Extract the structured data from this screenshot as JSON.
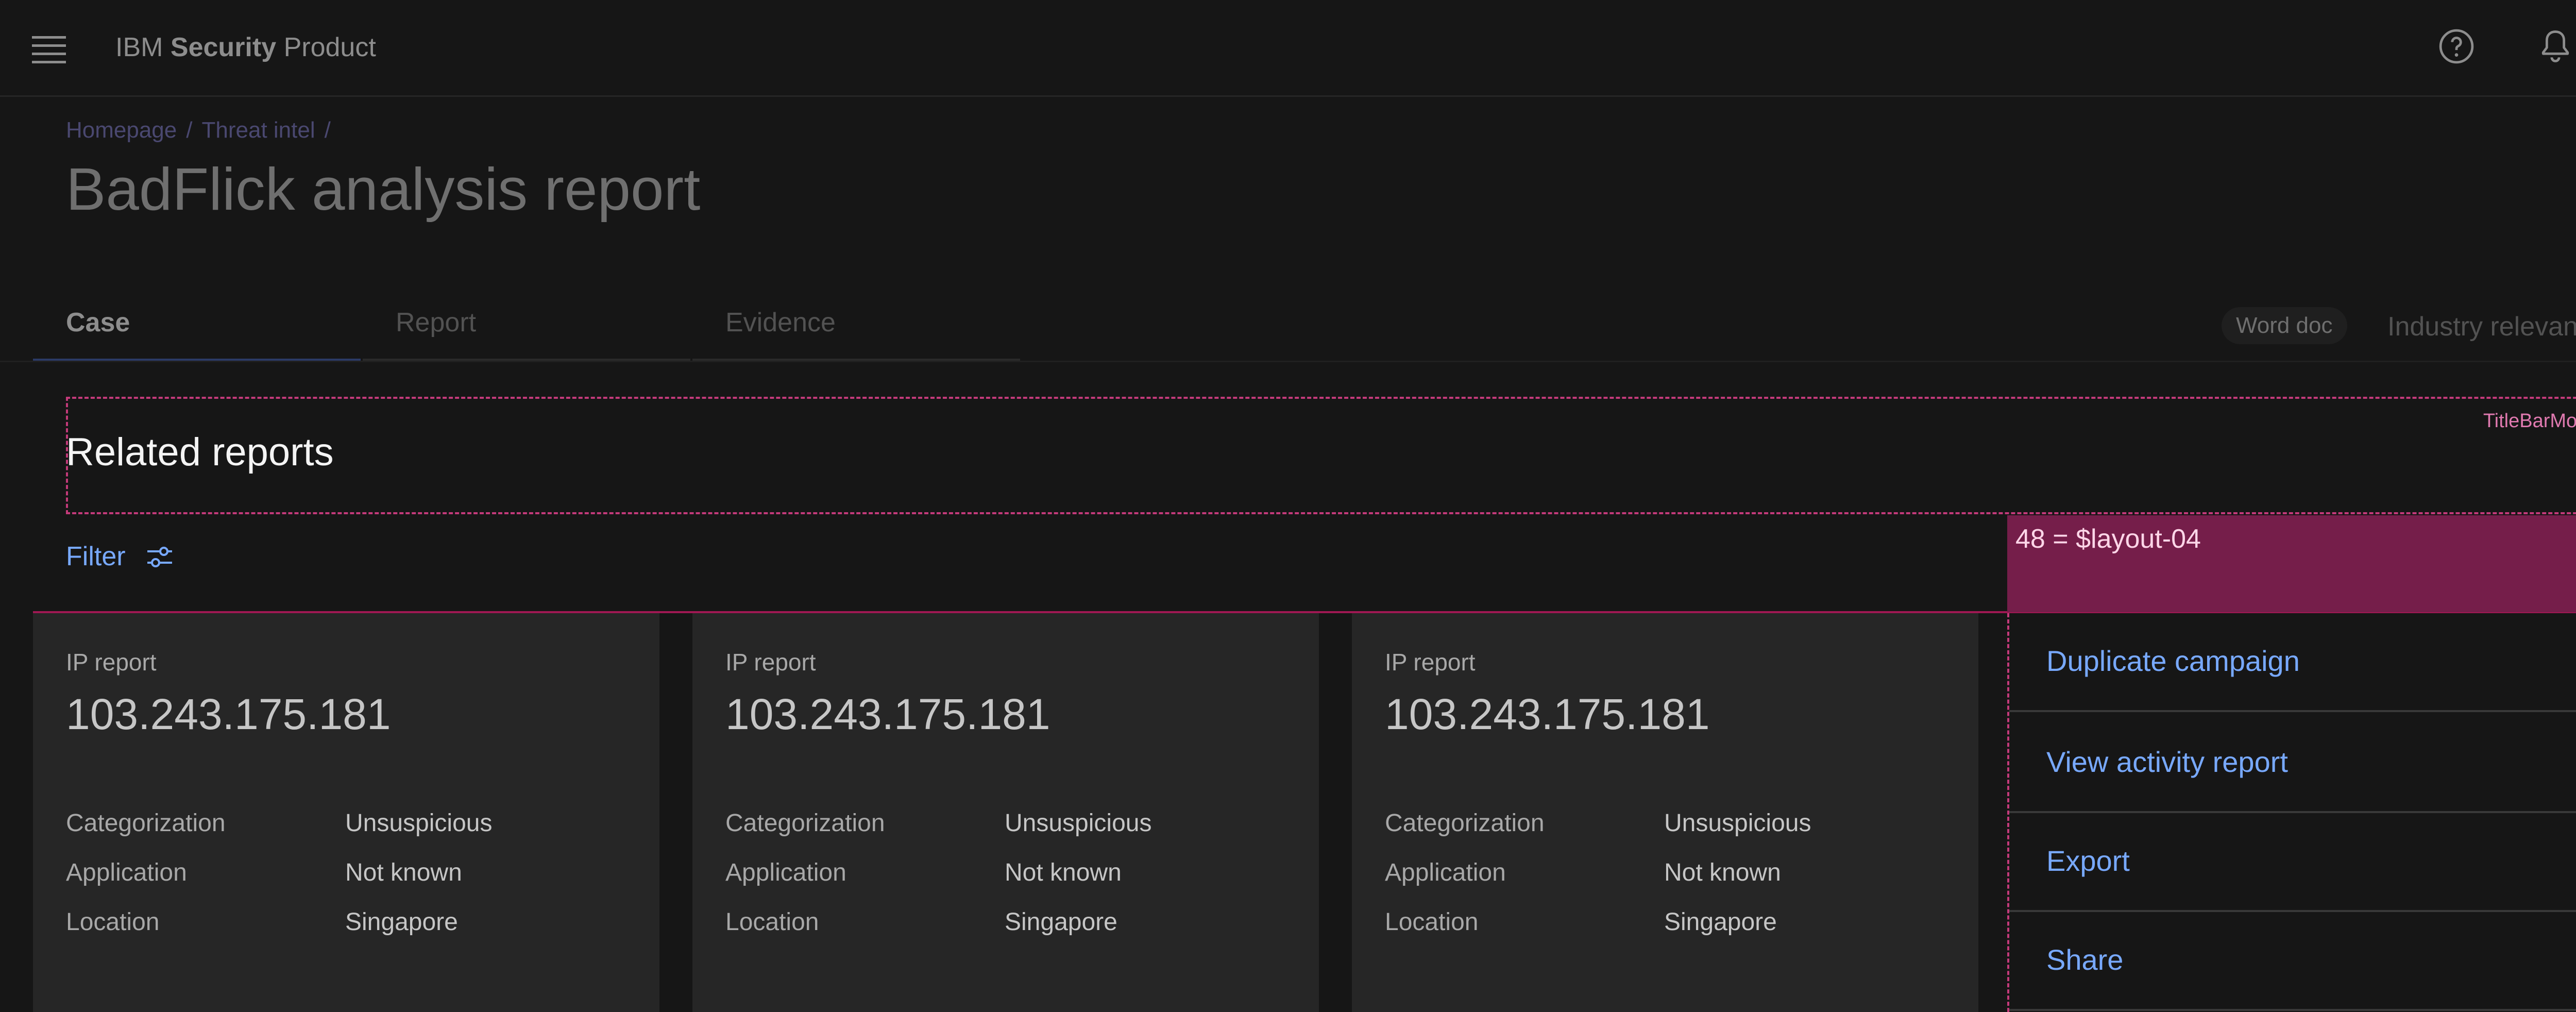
{
  "header": {
    "brand_prefix": "IBM",
    "brand_bold": "Security",
    "brand_suffix": "Product",
    "icons": [
      "menu-icon",
      "help-icon",
      "notification-icon",
      "avatar"
    ]
  },
  "breadcrumb": {
    "items": [
      "Homepage",
      "Threat intel"
    ],
    "separator": "/"
  },
  "page_title": "BadFlick analysis report",
  "tabs": [
    {
      "label": "Case",
      "active": true
    },
    {
      "label": "Report",
      "active": false
    },
    {
      "label": "Evidence",
      "active": false
    }
  ],
  "tab_actions": {
    "word_doc": "Word doc",
    "industry_relevancy": "Industry relevancy"
  },
  "titlebar": {
    "module_tag": "TitleBarModule",
    "title": "Related reports"
  },
  "filter": {
    "label": "Filter",
    "icon": "settings-adjust-icon"
  },
  "spacing_annotation": "48 = $layout-04",
  "cards": [
    {
      "type": "IP report",
      "ip": "103.243.175.181",
      "rows": [
        {
          "key": "Categorization",
          "value": "Unsuspicious"
        },
        {
          "key": "Application",
          "value": "Not known"
        },
        {
          "key": "Location",
          "value": "Singapore"
        }
      ]
    },
    {
      "type": "IP report",
      "ip": "103.243.175.181",
      "rows": [
        {
          "key": "Categorization",
          "value": "Unsuspicious"
        },
        {
          "key": "Application",
          "value": "Not known"
        },
        {
          "key": "Location",
          "value": "Singapore"
        }
      ]
    },
    {
      "type": "IP report",
      "ip": "103.243.175.181",
      "rows": [
        {
          "key": "Categorization",
          "value": "Unsuspicious"
        },
        {
          "key": "Application",
          "value": "Not known"
        },
        {
          "key": "Location",
          "value": "Singapore"
        }
      ]
    }
  ],
  "actions": [
    {
      "label": "Duplicate campaign",
      "icon": "copy-icon"
    },
    {
      "label": "View activity report",
      "icon": "activity-icon"
    },
    {
      "label": "Export",
      "icon": "upload-icon"
    },
    {
      "label": "Share",
      "icon": "share-icon"
    }
  ],
  "colors": {
    "background": "#161616",
    "card": "#262626",
    "link": "#78a9ff",
    "annotation": "#751e4a",
    "annotation_border": "#c33a7a"
  }
}
